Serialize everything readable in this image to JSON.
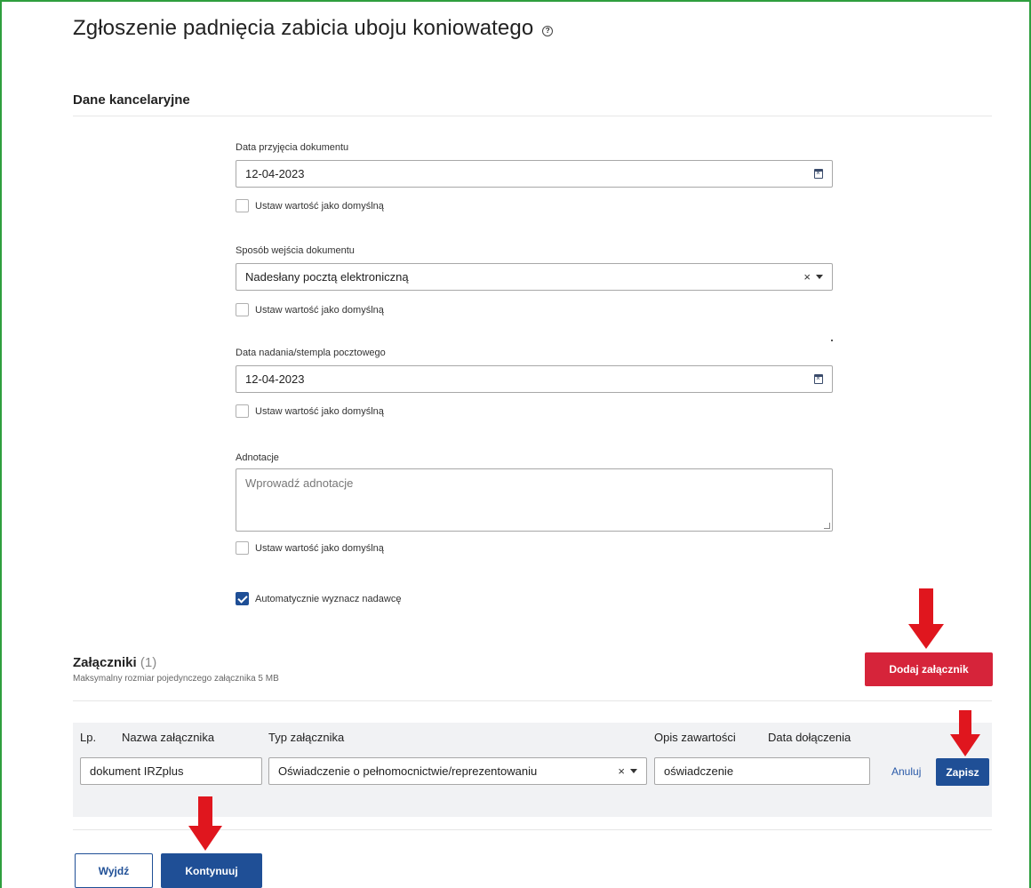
{
  "page": {
    "title": "Zgłoszenie padnięcia zabicia uboju koniowatego",
    "help_icon": "question-circle-icon"
  },
  "office_data": {
    "section_title": "Dane kancelaryjne",
    "acceptance_date": {
      "label": "Data przyjęcia dokumentu",
      "value": "12-04-2023",
      "icon": "calendar-icon",
      "default_checkbox": {
        "label": "Ustaw wartość jako domyślną",
        "checked": false
      }
    },
    "entry_method": {
      "label": "Sposób wejścia dokumentu",
      "value": "Nadesłany pocztą elektroniczną",
      "clear_glyph": "×",
      "default_checkbox": {
        "label": "Ustaw wartość jako domyślną",
        "checked": false
      }
    },
    "postmark_date": {
      "label": "Data nadania/stempla pocztowego",
      "value": "12-04-2023",
      "icon": "calendar-icon",
      "default_checkbox": {
        "label": "Ustaw wartość jako domyślną",
        "checked": false
      }
    },
    "annotations": {
      "label": "Adnotacje",
      "value": "",
      "placeholder": "Wprowadź adnotacje",
      "default_checkbox": {
        "label": "Ustaw wartość jako domyślną",
        "checked": false
      }
    },
    "auto_sender": {
      "label": "Automatycznie wyznacz nadawcę",
      "checked": true
    }
  },
  "attachments": {
    "title": "Załączniki",
    "count": "(1)",
    "subtitle": "Maksymalny rozmiar pojedynczego załącznika 5 MB",
    "add_button": "Dodaj załącznik",
    "columns": [
      "Lp.",
      "Nazwa załącznika",
      "Typ załącznika",
      "Opis zawartości",
      "Data dołączenia"
    ],
    "edit_row": {
      "name": "dokument IRZplus",
      "type": "Oświadczenie o pełnomocnictwie/reprezentowaniu",
      "type_clear_glyph": "×",
      "description": "oświadczenie",
      "cancel": "Anuluj",
      "save": "Zapisz"
    }
  },
  "footer": {
    "exit_button": "Wyjdź",
    "continue_button": "Kontynuuj"
  },
  "colors": {
    "frame": "#2e9e3e",
    "primary": "#1f4f96",
    "danger": "#d6243a",
    "annotation_arrow": "#e0161e"
  }
}
